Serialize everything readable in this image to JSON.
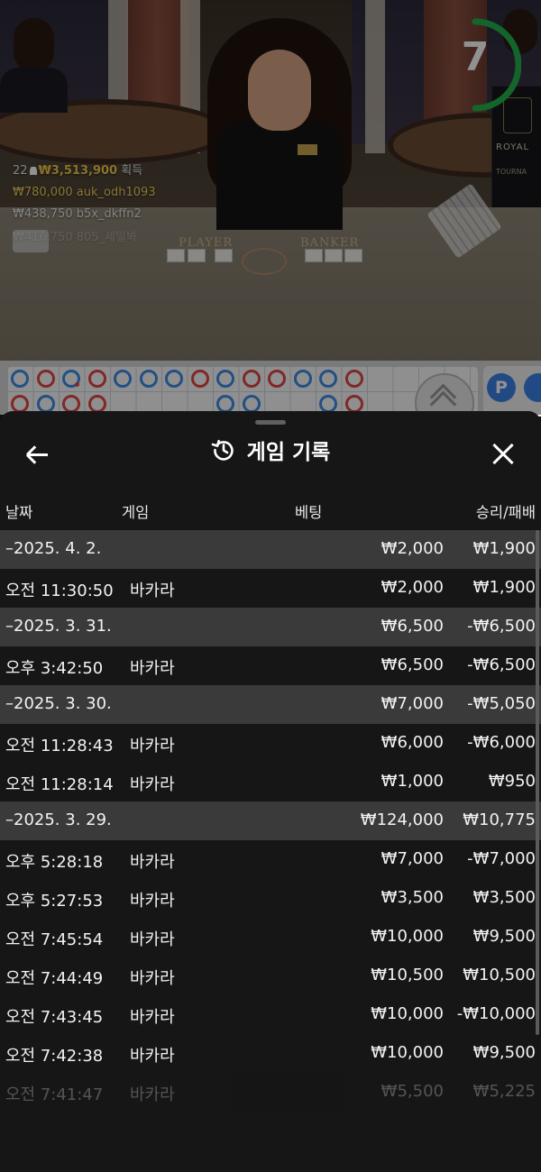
{
  "video": {
    "round_players_count": "22",
    "round_total": "₩3,513,900",
    "round_suffix": "획득",
    "winners": [
      {
        "amount": "₩780,000",
        "user": "auk_odh1093"
      },
      {
        "amount": "₩438,750",
        "user": "b5x_dkffn2"
      },
      {
        "amount": "₩416,750",
        "user": "805_세밀봐"
      }
    ],
    "timer_value": "7",
    "table_labels": {
      "player": "PLAYER",
      "banker": "BANKER"
    },
    "sign_text": {
      "brand": "ROYAL",
      "sub": "TOURNA"
    }
  },
  "roadmap": {
    "side_chip_label": "P",
    "beads": [
      {
        "col": 0,
        "row": 0,
        "color": "blue"
      },
      {
        "col": 1,
        "row": 0,
        "color": "red"
      },
      {
        "col": 2,
        "row": 0,
        "color": "blue",
        "dot": true
      },
      {
        "col": 3,
        "row": 0,
        "color": "red"
      },
      {
        "col": 4,
        "row": 0,
        "color": "blue"
      },
      {
        "col": 5,
        "row": 0,
        "color": "blue"
      },
      {
        "col": 6,
        "row": 0,
        "color": "blue"
      },
      {
        "col": 7,
        "row": 0,
        "color": "red"
      },
      {
        "col": 8,
        "row": 0,
        "color": "blue"
      },
      {
        "col": 9,
        "row": 0,
        "color": "red"
      },
      {
        "col": 10,
        "row": 0,
        "color": "red"
      },
      {
        "col": 11,
        "row": 0,
        "color": "blue"
      },
      {
        "col": 12,
        "row": 0,
        "color": "blue"
      },
      {
        "col": 13,
        "row": 0,
        "color": "red"
      },
      {
        "col": 0,
        "row": 1,
        "color": "red"
      },
      {
        "col": 1,
        "row": 1,
        "color": "blue"
      },
      {
        "col": 2,
        "row": 1,
        "color": "red"
      },
      {
        "col": 3,
        "row": 1,
        "color": "red"
      },
      {
        "col": 8,
        "row": 1,
        "color": "blue"
      },
      {
        "col": 9,
        "row": 1,
        "color": "blue"
      },
      {
        "col": 12,
        "row": 1,
        "color": "blue"
      },
      {
        "col": 13,
        "row": 1,
        "color": "red"
      }
    ]
  },
  "sheet": {
    "title": "게임 기록",
    "columns": {
      "date": "날짜",
      "game": "게임",
      "bet": "베팅",
      "result": "승리/패배"
    },
    "rows": [
      {
        "type": "date",
        "label": "–2025. 4. 2.",
        "bet": "₩2,000",
        "result": "₩1,900"
      },
      {
        "type": "game",
        "time": "오전 11:30:50",
        "game": "바카라",
        "bet": "₩2,000",
        "result": "₩1,900"
      },
      {
        "type": "date",
        "label": "–2025. 3. 31.",
        "bet": "₩6,500",
        "result": "-₩6,500"
      },
      {
        "type": "game",
        "time": "오후 3:42:50",
        "game": "바카라",
        "bet": "₩6,500",
        "result": "-₩6,500"
      },
      {
        "type": "date",
        "label": "–2025. 3. 30.",
        "bet": "₩7,000",
        "result": "-₩5,050"
      },
      {
        "type": "game",
        "time": "오전 11:28:43",
        "game": "바카라",
        "bet": "₩6,000",
        "result": "-₩6,000"
      },
      {
        "type": "game",
        "time": "오전 11:28:14",
        "game": "바카라",
        "bet": "₩1,000",
        "result": "₩950"
      },
      {
        "type": "date",
        "label": "–2025. 3. 29.",
        "bet": "₩124,000",
        "result": "₩10,775"
      },
      {
        "type": "game",
        "time": "오후 5:28:18",
        "game": "바카라",
        "bet": "₩7,000",
        "result": "-₩7,000"
      },
      {
        "type": "game",
        "time": "오후 5:27:53",
        "game": "바카라",
        "bet": "₩3,500",
        "result": "₩3,500"
      },
      {
        "type": "game",
        "time": "오전 7:45:54",
        "game": "바카라",
        "bet": "₩10,000",
        "result": "₩9,500"
      },
      {
        "type": "game",
        "time": "오전 7:44:49",
        "game": "바카라",
        "bet": "₩10,500",
        "result": "₩10,500"
      },
      {
        "type": "game",
        "time": "오전 7:43:45",
        "game": "바카라",
        "bet": "₩10,000",
        "result": "-₩10,000"
      },
      {
        "type": "game",
        "time": "오전 7:42:38",
        "game": "바카라",
        "bet": "₩10,000",
        "result": "₩9,500"
      },
      {
        "type": "game",
        "time": "오전 7:41:47",
        "game": "바카라",
        "bet": "₩5,500",
        "result": "₩5,225",
        "faded": true
      }
    ]
  },
  "colors": {
    "timer_ring": "#22b24c",
    "banker": "#e24747",
    "player": "#3d8ee8"
  }
}
